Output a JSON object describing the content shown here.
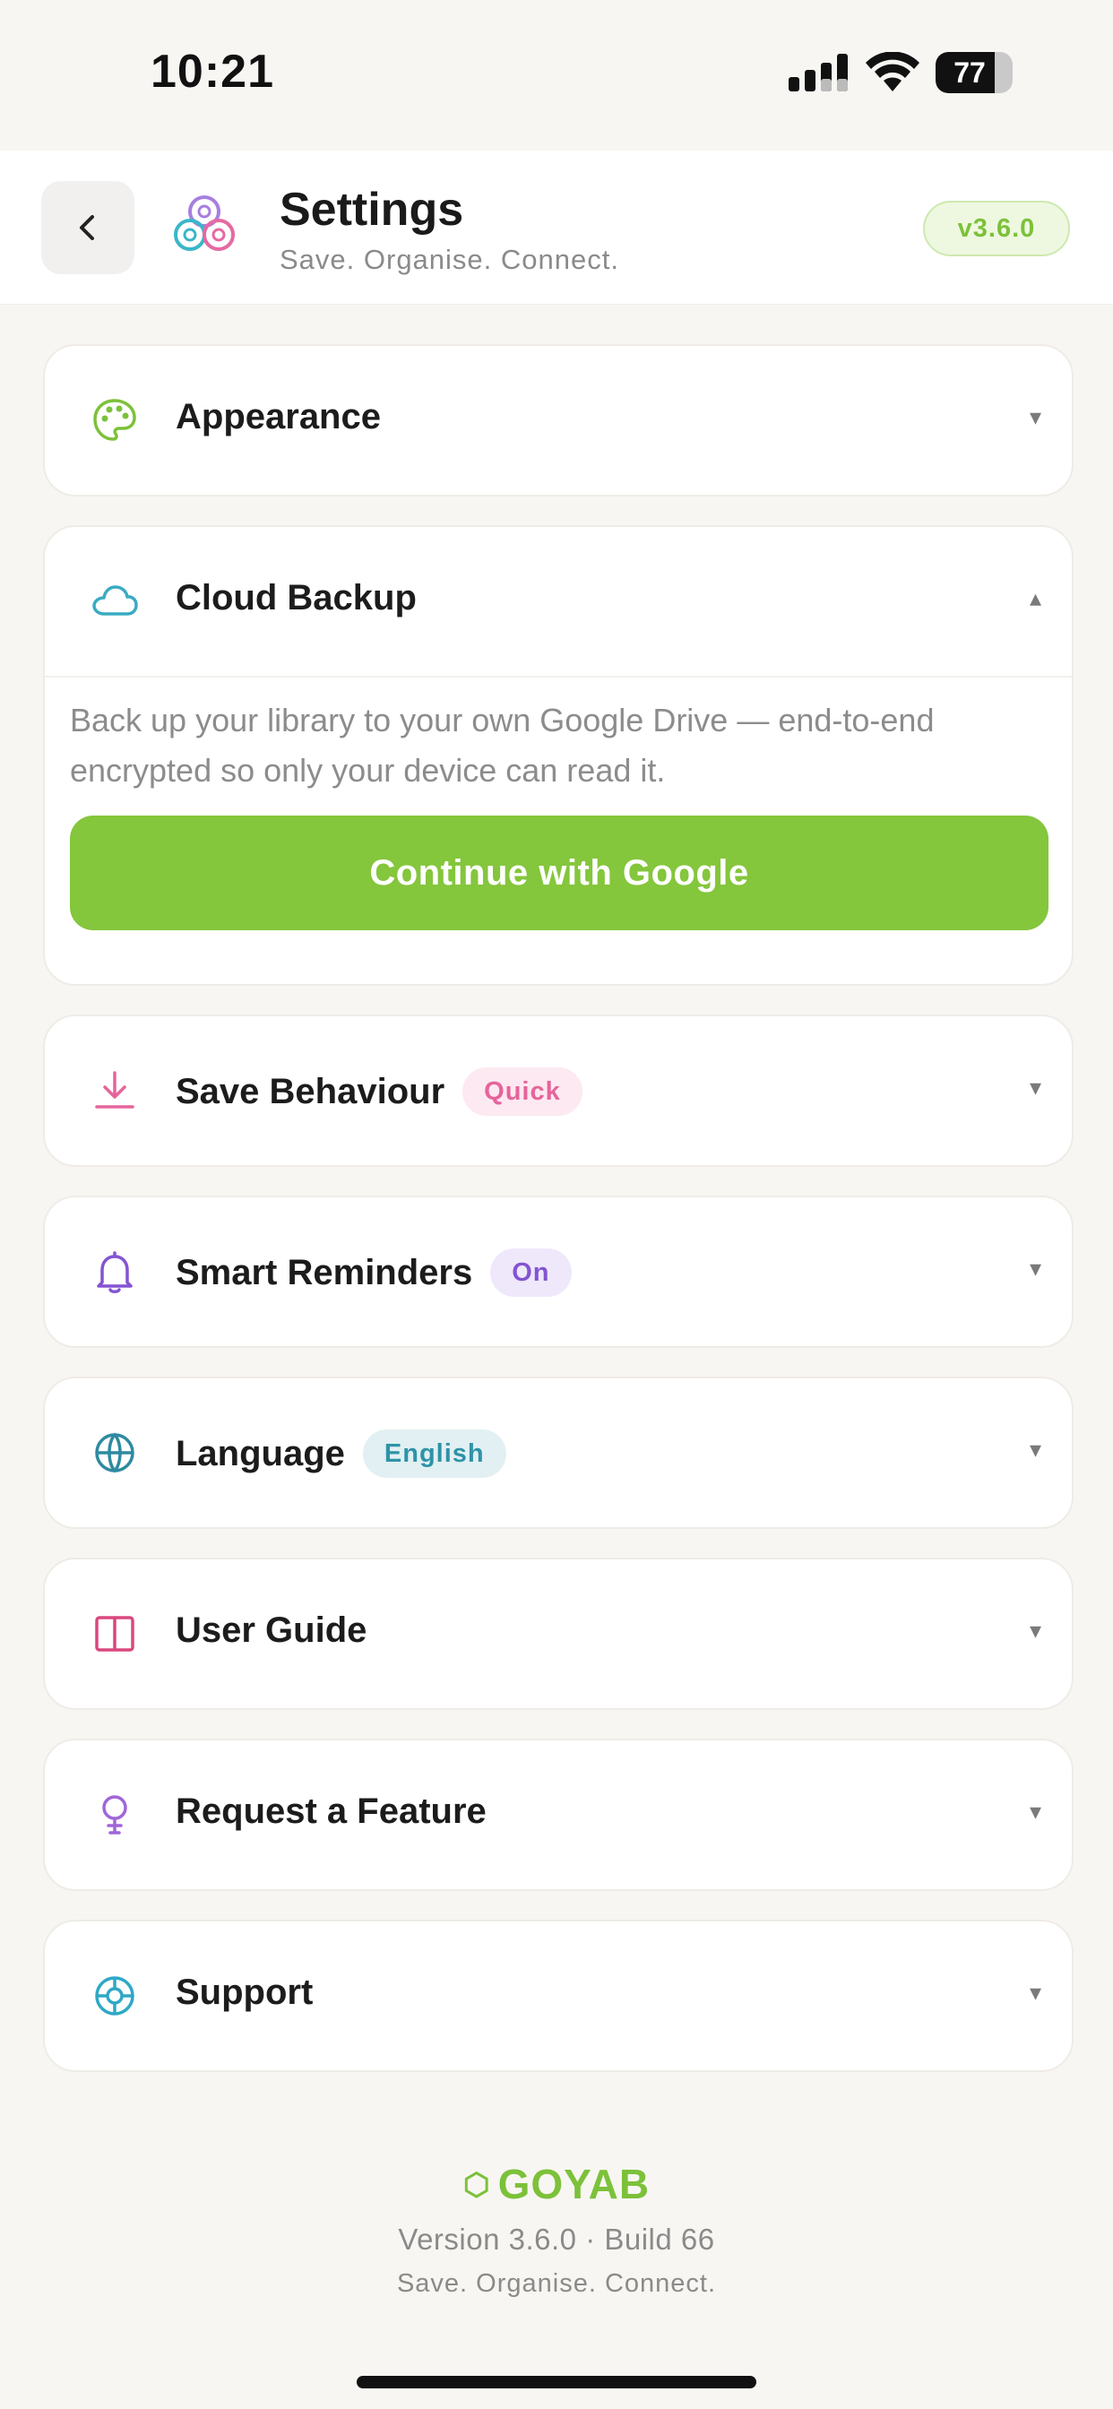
{
  "status_bar": {
    "time": "10:21",
    "battery": "77",
    "battery_level": 0.77
  },
  "header": {
    "back_icon": "chevron-left-icon",
    "logo_icon": "three-rings-logo",
    "title": "Settings",
    "subtitle": "Save. Organise. Connect.",
    "version": "v3.6.0"
  },
  "sections": {
    "appearance": {
      "label": "Appearance",
      "icon": "palette-icon",
      "state": "collapsed"
    },
    "cloud_backup": {
      "label": "Cloud Backup",
      "icon": "cloud-icon",
      "state": "expanded",
      "description": "Back up your library to your own Google Drive — end-to-end encrypted so only your device can read it.",
      "button": "Continue with Google"
    },
    "save_behaviour": {
      "label": "Save Behaviour",
      "badge": "Quick",
      "icon": "download-icon",
      "state": "collapsed"
    },
    "smart_reminders": {
      "label": "Smart Reminders",
      "badge": "On",
      "icon": "bell-icon",
      "state": "collapsed"
    },
    "language": {
      "label": "Language",
      "badge": "English",
      "icon": "globe-icon",
      "state": "collapsed"
    },
    "user_guide": {
      "label": "User Guide",
      "icon": "book-icon",
      "state": "collapsed"
    },
    "request_feature": {
      "label": "Request a Feature",
      "icon": "lightbulb-icon",
      "state": "collapsed"
    },
    "support": {
      "label": "Support",
      "icon": "lifebuoy-icon",
      "state": "collapsed"
    }
  },
  "chevrons": {
    "down": "▾",
    "up": "▴"
  },
  "footer": {
    "brand_icon": "⬡",
    "brand": "GOYAB",
    "version": "Version 3.6.0 · Build 66",
    "tagline": "Save. Organise. Connect."
  },
  "colors": {
    "accent_green": "#84c63c",
    "background": "#f8f6f2",
    "card": "#ffffff"
  }
}
